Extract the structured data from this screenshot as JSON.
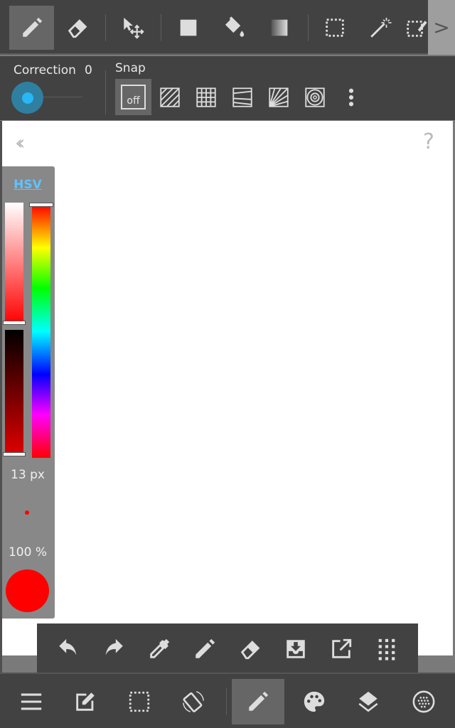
{
  "toolbar": {
    "tools": [
      "pen-tool",
      "eraser-tool",
      "move-tool",
      "fill-rect-tool",
      "bucket-tool",
      "gradient-tool",
      "select-tool",
      "magic-wand-tool",
      "select-pen-tool"
    ],
    "active": "pen-tool",
    "more_label": ">"
  },
  "options": {
    "correction_label": "Correction",
    "correction_value": "0",
    "snap_label": "Snap",
    "snap_off_label": "off",
    "snap_modes": [
      "off",
      "parallel",
      "grid",
      "perspective-lines",
      "radial",
      "concentric"
    ]
  },
  "canvas": {
    "back_label": "‹‹",
    "help_label": "?"
  },
  "color_panel": {
    "mode_label": "HSV",
    "brush_size": "13 px",
    "opacity": "100 %",
    "current_color": "#ff0000",
    "hue": 0,
    "saturation": 100,
    "value": 100
  },
  "quick_bar": [
    "undo",
    "redo",
    "eyedropper",
    "pen",
    "eraser",
    "save",
    "export",
    "grid-menu"
  ],
  "bottom_bar": {
    "items": [
      "menu",
      "edit",
      "selection",
      "rotate",
      "brush",
      "color",
      "layers",
      "material"
    ],
    "active": "brush"
  },
  "colors": {
    "accent": "#29b6f6",
    "bar": "#424242",
    "active": "#666666"
  }
}
